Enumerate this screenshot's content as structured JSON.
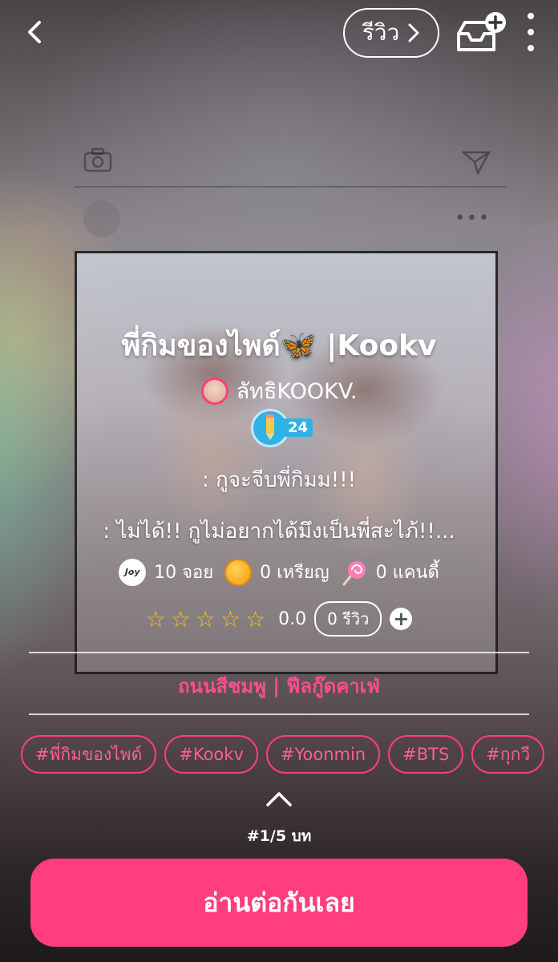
{
  "header": {
    "review_label": "รีวิว",
    "review_chevron": ">"
  },
  "story": {
    "title": "พี่กิมของไพด์🦋 |Kookv",
    "author": "ลัทธิKOOKV.",
    "author_level": "24",
    "line1": ": กูจะจีบพี่กิมม!!!",
    "line2": ": ไม่ได้!! กูไม่อยากได้มึงเป็นพี่สะไภ้!!..."
  },
  "stats": {
    "joy_icon_text": "Joy",
    "joy": "10 จอย",
    "coins": "0 เหรียญ",
    "candy": "0 แคนดี้"
  },
  "rating": {
    "stars": "☆☆☆☆☆",
    "score": "0.0",
    "review_count": "0 รีวิว",
    "add": "+"
  },
  "category": "ถนนสีชมพู | ฟีลกู๊ดคาเฟ่",
  "tags": [
    "#พี่กิมของไพด์",
    "#Kookv",
    "#Yoonmin",
    "#BTS",
    "#กุกวี"
  ],
  "chapter": "#1/5 บท",
  "read_button": "อ่านต่อกันเลย",
  "colors": {
    "accent": "#ff3d7f",
    "star": "#f5c518",
    "level": "#2fb3e6"
  }
}
